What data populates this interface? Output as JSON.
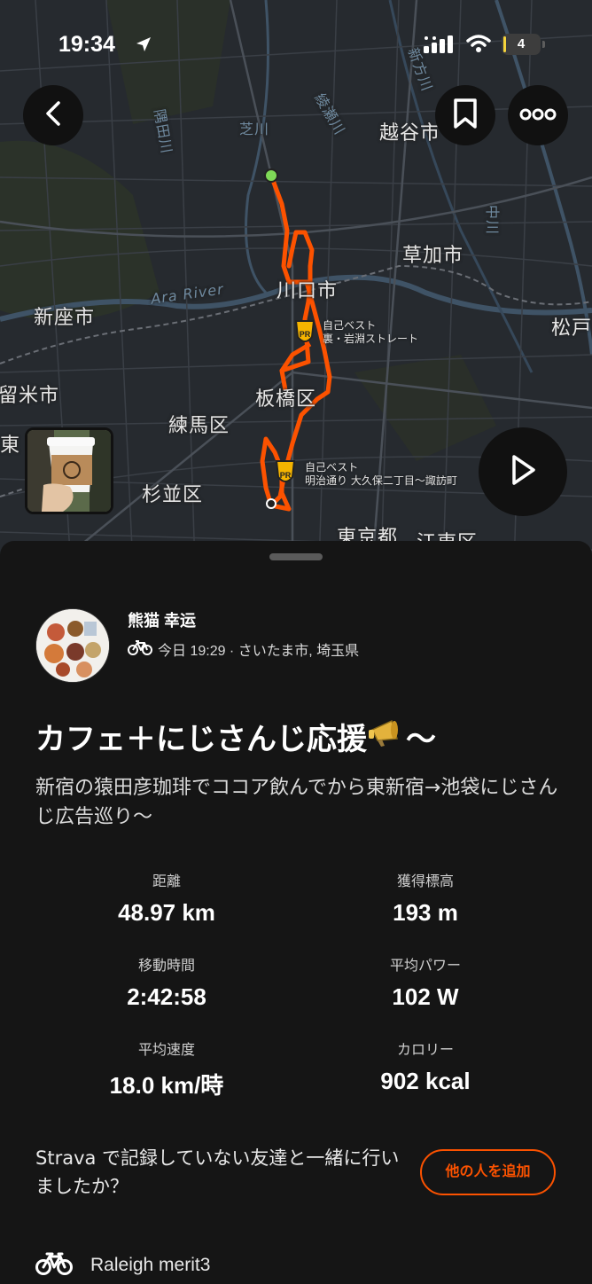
{
  "status_bar": {
    "time": "19:34",
    "battery": "4"
  },
  "map": {
    "labels": {
      "koshigaya": "越谷市",
      "soka": "草加市",
      "kawaguchi": "川口市",
      "niiza": "新座市",
      "kurume": "留米市",
      "itabashi": "板橋区",
      "nerima": "練馬区",
      "higashi": "東",
      "suginami": "杉並区",
      "tokyo": "東京都",
      "koto": "江東区",
      "matsudo": "松戸",
      "ara_river": "Ara River",
      "shiba": "芝川",
      "ayase": "綾瀬川",
      "shinkashi": "新方川",
      "nakagawa": "中川",
      "sumida": "隅田川"
    },
    "pr_segments": [
      {
        "line1": "自己ベスト",
        "line2": "裏・岩淵ストレート"
      },
      {
        "line1": "自己ベスト",
        "line2": "明治通り 大久保二丁目〜諏訪町"
      }
    ]
  },
  "activity": {
    "athlete_name": "熊猫 幸运",
    "meta": "今日 19:29 · さいたま市, 埼玉県",
    "title": "カフェ＋にじさんじ応援",
    "title_suffix": "〜",
    "description": "新宿の猿田彦珈琲でココア飲んでから東新宿→池袋にじさんじ広告巡り〜"
  },
  "stats": [
    {
      "label": "距離",
      "value": "48.97 km"
    },
    {
      "label": "獲得標高",
      "value": "193 m"
    },
    {
      "label": "移動時間",
      "value": "2:42:58"
    },
    {
      "label": "平均パワー",
      "value": "102 W"
    },
    {
      "label": "平均速度",
      "value": "18.0 km/時"
    },
    {
      "label": "カロリー",
      "value": "902 kcal"
    }
  ],
  "friends_prompt": "Strava で記録していない友達と一緒に行いましたか？",
  "add_people_label": "他の人を追加",
  "gear": "Raleigh merit3",
  "colors": {
    "accent": "#fc5200",
    "route": "#fc5200",
    "start_marker": "#7ed957",
    "pr_badge": "#f5b400"
  },
  "icons": [
    "location-arrow-icon",
    "signal-icon",
    "wifi-icon",
    "back-chevron-icon",
    "bookmark-icon",
    "more-icon",
    "play-icon",
    "bike-icon",
    "pr-badge-icon",
    "megaphone-icon"
  ]
}
